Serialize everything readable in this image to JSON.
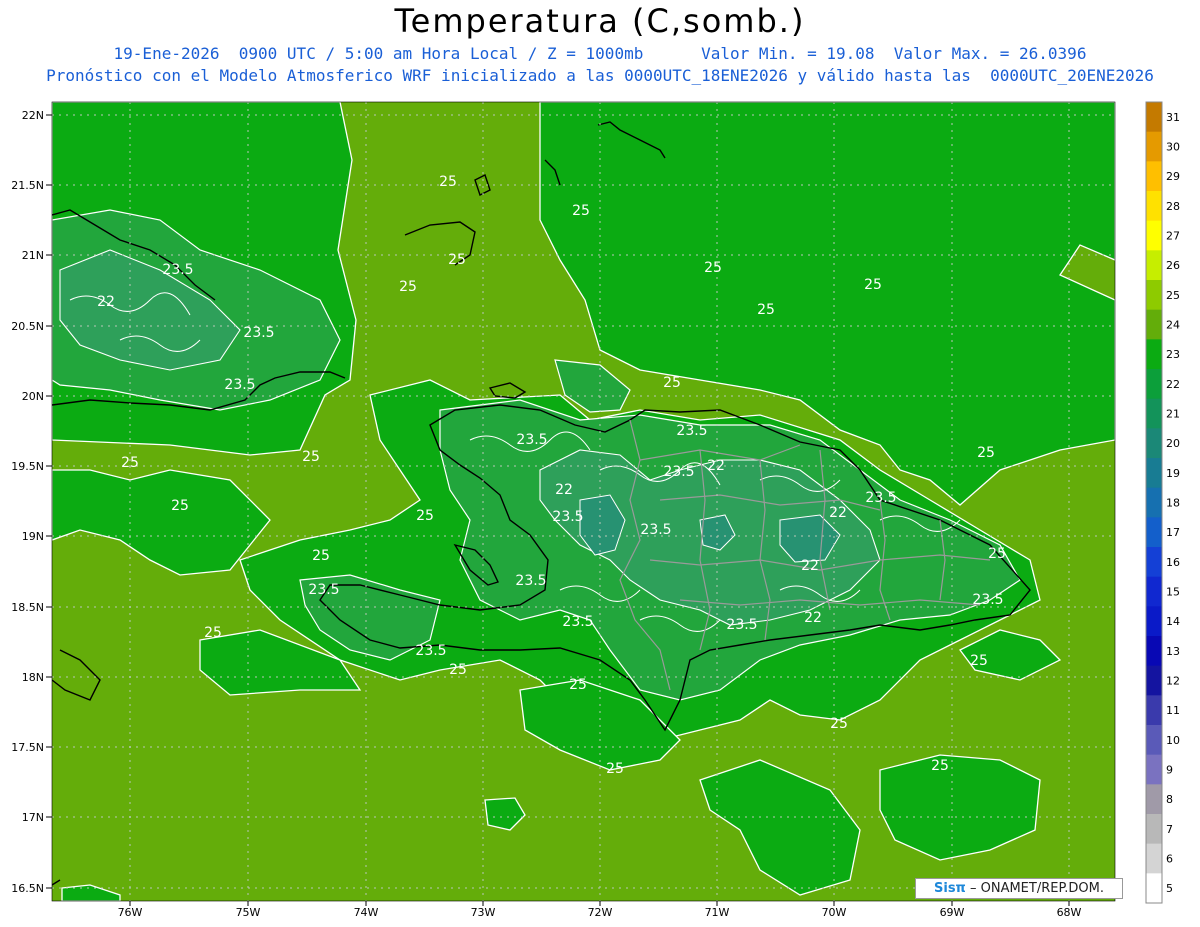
{
  "header": {
    "title": "Temperatura (C,somb.)",
    "subtitle1": "19-Ene-2026  0900 UTC / 5:00 am Hora Local / Z = 1000mb      Valor Min. = 19.08  Valor Max. = 26.0396",
    "subtitle2": "Pronóstico con el Modelo Atmosferico WRF inicializado a las 0000UTC_18ENE2026 y válido hasta las  0000UTC_20ENE2026"
  },
  "map": {
    "lat_labels": [
      "22N",
      "21.5N",
      "21N",
      "20.5N",
      "20N",
      "19.5N",
      "19N",
      "18.5N",
      "18N",
      "17.5N",
      "17N",
      "16.5N"
    ],
    "lon_labels": [
      "76W",
      "75W",
      "74W",
      "73W",
      "72W",
      "71W",
      "70W",
      "69W",
      "68W"
    ],
    "contour_labels": [
      "25",
      "25",
      "25",
      "25",
      "25",
      "25",
      "25",
      "25",
      "25",
      "25",
      "25",
      "25",
      "25",
      "25",
      "25",
      "25",
      "25",
      "25",
      "25",
      "25",
      "25",
      "25",
      "23.5",
      "23.5",
      "23.5",
      "23.5",
      "23.5",
      "23.5",
      "23.5",
      "23.5",
      "23.5",
      "23.5",
      "23.5",
      "23.5",
      "23.5",
      "23.5",
      "23.5",
      "22",
      "22",
      "22",
      "22",
      "22",
      "22"
    ],
    "colors": {
      "field_25_26": "#64ad0a",
      "field_24_25": "#0bab12",
      "field_23_24": "#22a63c",
      "field_22_23": "#2ea05a",
      "field_21_22": "#279272",
      "coast": "#000000",
      "borders": "#9a9a9a",
      "contours": "#ffffff"
    }
  },
  "colorbar": {
    "labels": [
      "31",
      "30",
      "29",
      "28",
      "27",
      "26",
      "25",
      "24",
      "23",
      "22",
      "21",
      "20",
      "19",
      "18",
      "17",
      "16",
      "15",
      "14",
      "13",
      "12",
      "11",
      "10",
      "9",
      "8",
      "7",
      "6",
      "5"
    ],
    "colors": [
      "#c47a00",
      "#e59a00",
      "#ffbf00",
      "#ffe100",
      "#ffff00",
      "#c6ee00",
      "#8ecb00",
      "#63ad0a",
      "#0bab12",
      "#0c9f3a",
      "#13935a",
      "#1b8877",
      "#187c93",
      "#1670b0",
      "#135fcb",
      "#1440d6",
      "#1028d0",
      "#0a1ac8",
      "#0808b4",
      "#1414a0",
      "#3a3aac",
      "#5a5ab8",
      "#7a72c0",
      "#a09aa8",
      "#b8b8b8",
      "#d4d4d4",
      "#ffffff"
    ]
  },
  "footer": {
    "brand": "Sisπ",
    "credit_text": " – ONAMET/REP.DOM."
  }
}
